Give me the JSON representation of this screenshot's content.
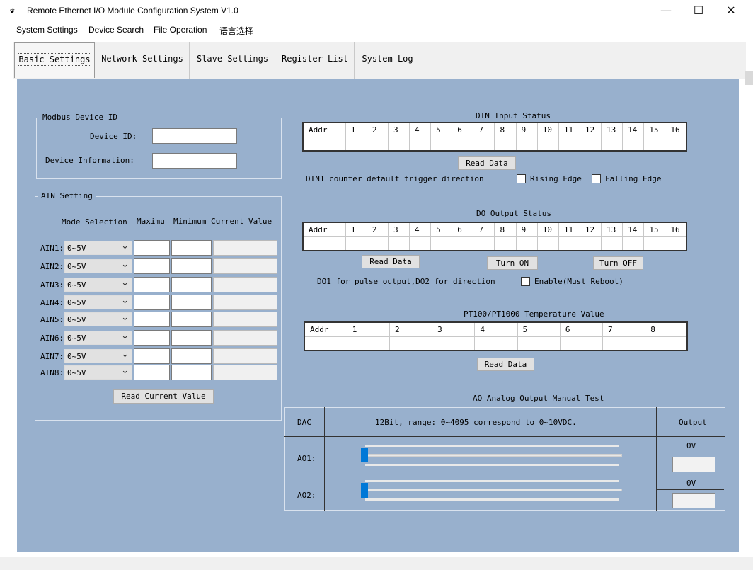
{
  "window": {
    "title": "Remote Ethernet I/O Module Configuration System V1.0",
    "icon_glyph": "❦",
    "minimize_glyph": "—",
    "maximize_glyph": "☐",
    "close_glyph": "✕"
  },
  "menu": [
    "System Settings",
    "Device Search",
    "File Operation",
    "语言选择"
  ],
  "tabs": [
    "Basic Settings",
    "Network Settings",
    "Slave Settings",
    "Register List",
    "System Log"
  ],
  "modbus": {
    "legend": "Modbus Device ID",
    "device_id_label": "Device ID:",
    "device_info_label": "Device Information:",
    "device_id_value": "",
    "device_info_value": ""
  },
  "ain": {
    "legend": "AIN Setting",
    "headers": {
      "mode": "Mode Selection",
      "max": "Maximu",
      "min": "Minimum",
      "current": "Current Value"
    },
    "rows": [
      {
        "label": "AIN1:",
        "mode": "0~5V"
      },
      {
        "label": "AIN2:",
        "mode": "0~5V"
      },
      {
        "label": "AIN3:",
        "mode": "0~5V"
      },
      {
        "label": "AIN4:",
        "mode": "0~5V"
      },
      {
        "label": "AIN5:",
        "mode": "0~5V"
      },
      {
        "label": "AIN6:",
        "mode": "0~5V"
      },
      {
        "label": "AIN7:",
        "mode": "0~5V"
      },
      {
        "label": "AIN8:",
        "mode": "0~5V"
      }
    ],
    "read_button": "Read Current Value"
  },
  "din": {
    "title": "DIN Input Status",
    "columns": [
      "Addr",
      "1",
      "2",
      "3",
      "4",
      "5",
      "6",
      "7",
      "8",
      "9",
      "10",
      "11",
      "12",
      "13",
      "14",
      "15",
      "16"
    ],
    "read_button": "Read Data",
    "counter_text": "DIN1 counter default trigger direction",
    "rising_label": "Rising Edge",
    "falling_label": "Falling Edge"
  },
  "do": {
    "title": "DO Output Status",
    "columns": [
      "Addr",
      "1",
      "2",
      "3",
      "4",
      "5",
      "6",
      "7",
      "8",
      "9",
      "10",
      "11",
      "12",
      "13",
      "14",
      "15",
      "16"
    ],
    "read_button": "Read Data",
    "on_button": "Turn ON",
    "off_button": "Turn OFF",
    "pulse_text": "DO1 for pulse output,DO2 for direction",
    "enable_label": "Enable(Must Reboot)"
  },
  "pt100": {
    "title": "PT100/PT1000 Temperature Value",
    "columns": [
      "Addr",
      "1",
      "2",
      "3",
      "4",
      "5",
      "6",
      "7",
      "8"
    ],
    "read_button": "Read Data"
  },
  "ao": {
    "title": "AO Analog Output Manual Test",
    "dac_header": "DAC",
    "range_header": "12Bit, range: 0~4095 correspond to 0~10VDC.",
    "output_header": "Output",
    "rows": [
      {
        "label": "AO1:",
        "output": "0V",
        "level": 0
      },
      {
        "label": "AO2:",
        "output": "0V",
        "level": 0
      }
    ]
  },
  "colors": {
    "panel": "#98b0cd",
    "slider_thumb": "#0078d7"
  }
}
